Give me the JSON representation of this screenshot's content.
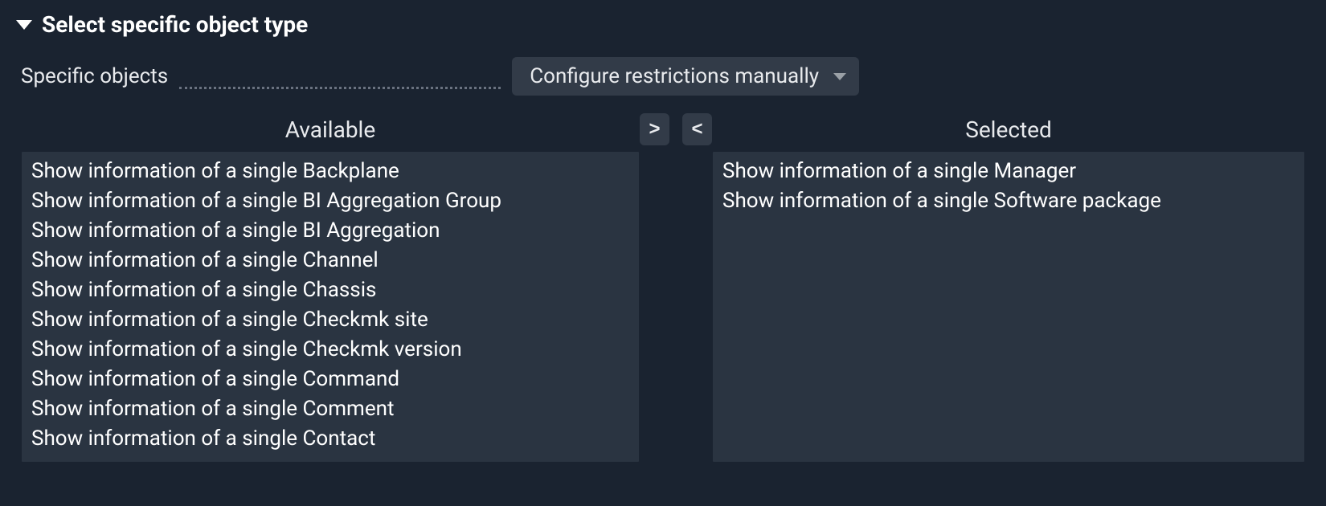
{
  "section": {
    "title": "Select specific object type"
  },
  "config": {
    "label": "Specific objects",
    "dropdown_selected": "Configure restrictions manually"
  },
  "transfer": {
    "available_header": "Available",
    "selected_header": "Selected",
    "move_right_label": ">",
    "move_left_label": "<",
    "available": [
      "Show information of a single Backplane",
      "Show information of a single BI Aggregation Group",
      "Show information of a single BI Aggregation",
      "Show information of a single Channel",
      "Show information of a single Chassis",
      "Show information of a single Checkmk site",
      "Show information of a single Checkmk version",
      "Show information of a single Command",
      "Show information of a single Comment",
      "Show information of a single Contact"
    ],
    "selected": [
      "Show information of a single Manager",
      "Show information of a single Software package"
    ]
  }
}
